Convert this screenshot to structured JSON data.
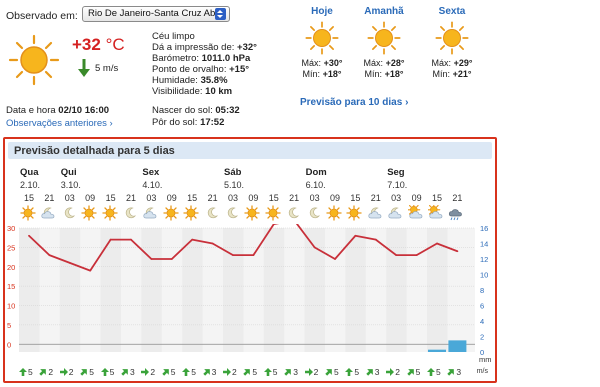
{
  "current": {
    "observed_label": "Observado em:",
    "location": "Rio De Janeiro-Santa Cruz Ab",
    "temperature": "+32",
    "unit": "°C",
    "wind": "5 m/s",
    "conditions": [
      {
        "label": "Céu limpo",
        "value": ""
      },
      {
        "label": "Dá a impressão de: ",
        "value": "+32°"
      },
      {
        "label": "Barómetro: ",
        "value": "1011.0 hPa"
      },
      {
        "label": "Ponto de orvalho: ",
        "value": "+15°"
      },
      {
        "label": "Humidade: ",
        "value": "35.8%"
      },
      {
        "label": "Visibilidade: ",
        "value": "10 km"
      }
    ],
    "datetime_label": "Data e hora ",
    "datetime_value": "02/10 16:00",
    "previous_obs": "Observações anteriores ›",
    "sunrise_label": "Nascer do sol: ",
    "sunrise": "05:32",
    "sunset_label": "Pôr do sol: ",
    "sunset": "17:52"
  },
  "days": [
    {
      "name": "Hoje",
      "max_label": "Máx: ",
      "max": "+30°",
      "min_label": "Mín: ",
      "min": "+18°",
      "icon": "sun-icon"
    },
    {
      "name": "Amanhã",
      "max_label": "Máx: ",
      "max": "+28°",
      "min_label": "Mín: ",
      "min": "+18°",
      "icon": "sun-icon"
    },
    {
      "name": "Sexta",
      "max_label": "Máx: ",
      "max": "+29°",
      "min_label": "Mín: ",
      "min": "+21°",
      "icon": "sun-icon"
    }
  ],
  "ten_day_link": "Previsão para 10 dias ›",
  "forecast": {
    "title": "Previsão detalhada para 5 dias",
    "days": [
      {
        "name": "Qua",
        "date": "2.10."
      },
      {
        "name": "Qui",
        "date": "3.10."
      },
      {
        "name": "Sex",
        "date": "4.10."
      },
      {
        "name": "Sáb",
        "date": "5.10."
      },
      {
        "name": "Dom",
        "date": "6.10."
      },
      {
        "name": "Seg",
        "date": "7.10."
      }
    ],
    "hours": [
      "15",
      "21",
      "03",
      "09",
      "15",
      "21",
      "03",
      "09",
      "15",
      "21",
      "03",
      "09",
      "15",
      "21",
      "03",
      "09",
      "15",
      "21",
      "03",
      "09",
      "15",
      "21"
    ],
    "icons": [
      "sun",
      "cloud-moon",
      "moon",
      "sun",
      "sun",
      "moon",
      "cloud-moon",
      "sun",
      "sun",
      "moon",
      "moon",
      "sun",
      "sun",
      "moon",
      "moon",
      "sun",
      "sun",
      "cloud-moon",
      "cloud-moon",
      "cloud-sun",
      "cloud-sun",
      "rain-cloud"
    ],
    "wind": [
      "5",
      "2",
      "2",
      "5",
      "5",
      "3",
      "2",
      "5",
      "5",
      "3",
      "2",
      "5",
      "5",
      "3",
      "2",
      "5",
      "5",
      "3",
      "2",
      "5",
      "5",
      "3"
    ],
    "wind_unit": "m/s",
    "precip_unit": "mm"
  },
  "chart_data": {
    "type": "line",
    "x": [
      "15",
      "21",
      "03",
      "09",
      "15",
      "21",
      "03",
      "09",
      "15",
      "21",
      "03",
      "09",
      "15",
      "21",
      "03",
      "09",
      "15",
      "21",
      "03",
      "09",
      "15",
      "21"
    ],
    "series": [
      {
        "values": [
          28,
          23,
          21,
          19,
          27,
          27,
          22,
          22,
          27,
          26,
          23,
          23,
          31,
          32,
          25,
          22,
          28,
          27,
          23,
          23,
          26,
          24
        ]
      }
    ],
    "ylim_left": [
      -2,
      30
    ],
    "yticks_left": [
      0,
      5,
      10,
      15,
      20,
      25,
      30
    ],
    "ylim_right": [
      0,
      16
    ],
    "yticks_right": [
      0,
      2,
      4,
      6,
      8,
      10,
      12,
      14,
      16
    ],
    "precipitation_mm": [
      0,
      0,
      0,
      0,
      0,
      0,
      0,
      0,
      0,
      0,
      0,
      0,
      0,
      0,
      0,
      0,
      0,
      0,
      0,
      0,
      0.3,
      1.5
    ],
    "colors": {
      "line": "#c8303a",
      "left_axis": "#d8321c",
      "right_axis": "#2a6ab8",
      "precip": "#4aa8d8"
    }
  }
}
